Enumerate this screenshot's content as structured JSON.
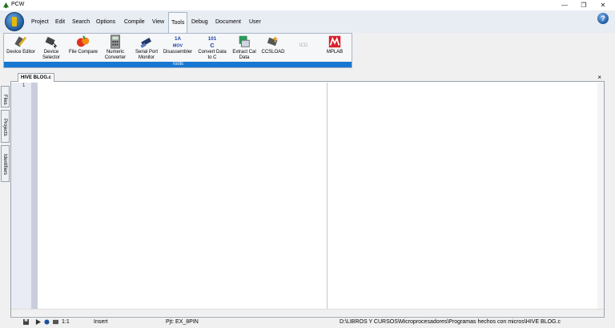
{
  "window": {
    "title": "PCW",
    "minimize_glyph": "—",
    "restore_glyph": "❐",
    "close_glyph": "✕"
  },
  "menu": {
    "items": [
      "Project",
      "Edit",
      "Search",
      "Options",
      "Compile",
      "View",
      "Tools",
      "Debug",
      "Document",
      "User"
    ],
    "active": "Tools",
    "help_glyph": "?"
  },
  "ribbon": {
    "group_caption": "Tools",
    "tools": [
      {
        "id": "device-editor",
        "line1": "Device Editor",
        "line2": ""
      },
      {
        "id": "device-selector",
        "line1": "Device",
        "line2": "Selector"
      },
      {
        "id": "file-compare",
        "line1": "File Compare",
        "line2": ""
      },
      {
        "id": "numeric-converter",
        "line1": "Numeric",
        "line2": "Converter"
      },
      {
        "id": "serial-port-monitor",
        "line1": "Serial Port",
        "line2": "Monitor"
      },
      {
        "id": "disassembler",
        "line1": "Disassembler",
        "line2": ""
      },
      {
        "id": "convert-data-to-c",
        "line1": "Convert Data",
        "line2": "to C"
      },
      {
        "id": "extract-cal-data",
        "line1": "Extract Cal",
        "line2": "Data"
      },
      {
        "id": "ccsload",
        "line1": "CCSLOAD",
        "line2": ""
      },
      {
        "id": "icd",
        "line1": "ICD",
        "line2": ""
      },
      {
        "id": "mplab",
        "line1": "MPLAB",
        "line2": ""
      }
    ],
    "disasm_top": "1A",
    "disasm_bottom": "MOV",
    "convert_top": "101",
    "convert_bottom": "C"
  },
  "editor": {
    "tab_label": "HIVE BLOG.c",
    "close_glyph": "×",
    "line_numbers": [
      "1"
    ]
  },
  "side_tabs": [
    "Files",
    "Projects",
    "Identifiers"
  ],
  "status": {
    "position": "1:1",
    "mode": "Insert",
    "project": "Pjt: EX_8PIN",
    "path": "D:\\LIBROS Y CURSOS\\Microprocesadores\\Programas hechos con micros\\HIVE BLOG.c"
  },
  "colors": {
    "accent": "#1877d1",
    "ribbon_bg": "#f6f7f9",
    "menubar_bg": "#e8ecf3"
  }
}
